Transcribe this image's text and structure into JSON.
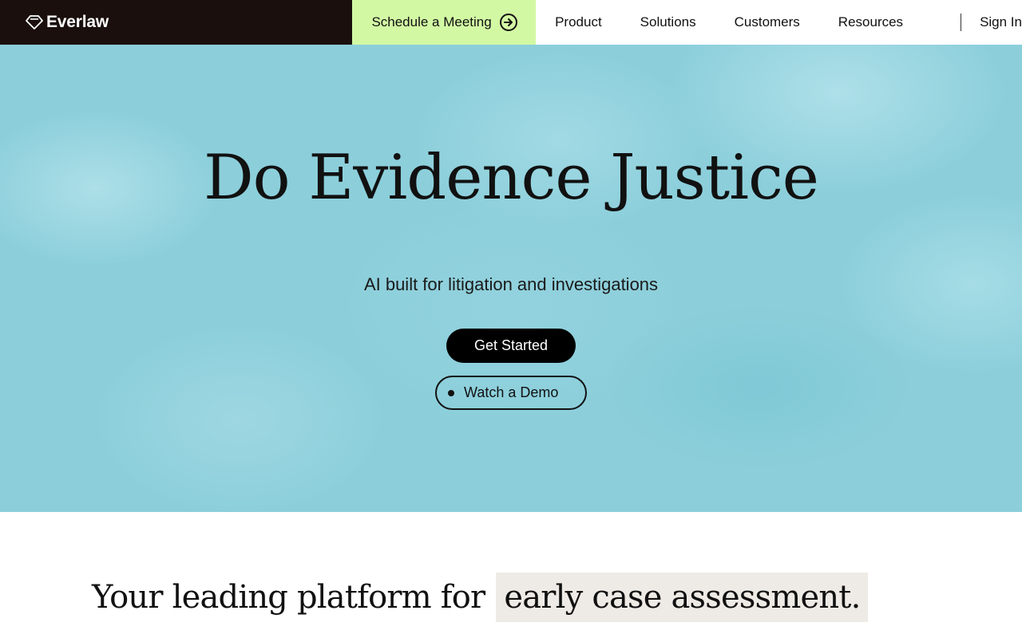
{
  "nav": {
    "brand": "Everlaw",
    "cta_label": "Schedule a Meeting",
    "cta_icon": "arrow-right-circle-icon",
    "links": [
      "Product",
      "Solutions",
      "Customers",
      "Resources"
    ],
    "signin_label": "Sign In"
  },
  "hero": {
    "title": "Do Evidence Justice",
    "subtitle": "AI built for litigation and investigations",
    "primary_button": "Get Started",
    "secondary_button": "Watch a Demo"
  },
  "platform": {
    "lead": "Your leading platform for",
    "highlight": "early case assessment."
  },
  "colors": {
    "brand_dark": "#1a0f0d",
    "cta_green": "#d3f8a4",
    "hero_teal": "#8ccfdb",
    "highlight_beige": "#eeebe6"
  }
}
